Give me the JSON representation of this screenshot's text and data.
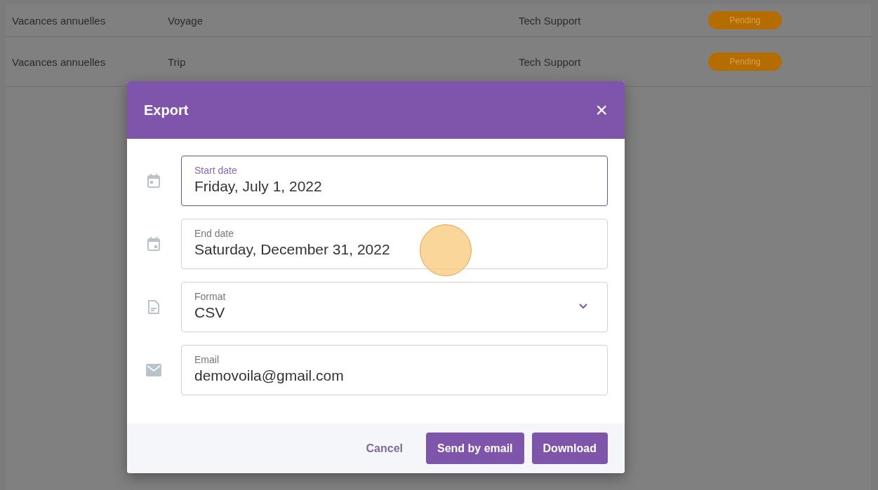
{
  "table": {
    "rows": [
      {
        "cells": [
          "Vacances annuelles",
          "Voyage",
          "Tech Support"
        ],
        "status": "Pending"
      },
      {
        "cells": [
          "Vacances annuelles",
          "Trip",
          "Tech Support"
        ],
        "status": "Pending"
      }
    ]
  },
  "dialog": {
    "title": "Export",
    "close": "×",
    "fields": [
      {
        "kind": "date",
        "label": "Start date",
        "value": "Friday, July 1, 2022",
        "focused": true
      },
      {
        "kind": "date",
        "label": "End date",
        "value": "Saturday, December 31, 2022",
        "focused": false
      },
      {
        "kind": "select",
        "label": "Format",
        "value": "CSV",
        "focused": false
      },
      {
        "kind": "text",
        "label": "Email",
        "value": "demovoila@gmail.com",
        "focused": false
      }
    ],
    "buttons": [
      {
        "label": "Cancel",
        "kind": "text"
      },
      {
        "label": "Send by email",
        "kind": "primary"
      },
      {
        "label": "Download",
        "kind": "primary"
      }
    ]
  }
}
